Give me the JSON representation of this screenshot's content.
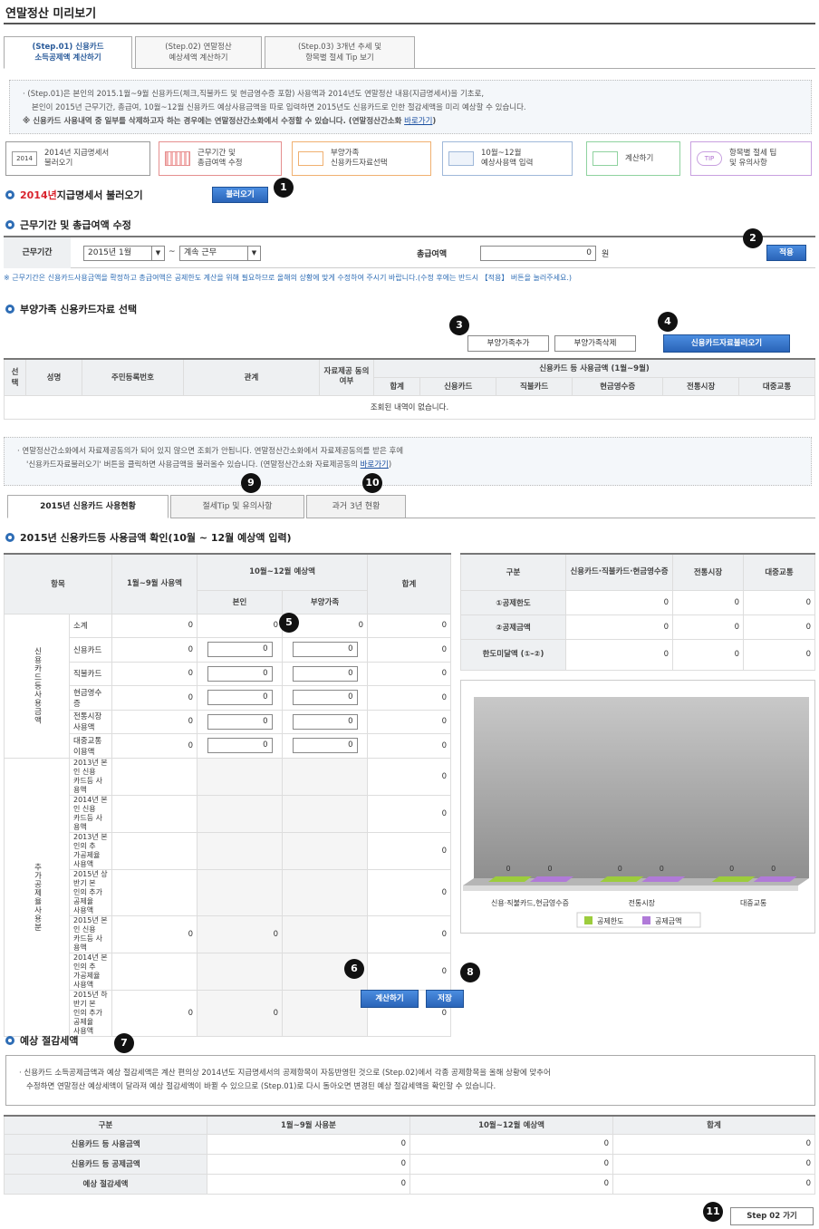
{
  "page": {
    "title": "연말정산 미리보기"
  },
  "steps": [
    {
      "line1": "(Step.01) 신용카드",
      "line2": "소득공제액 계산하기"
    },
    {
      "line1": "(Step.02) 연말정산",
      "line2": "예상세액 계산하기"
    },
    {
      "line1": "(Step.03) 3개년 추세 및",
      "line2": "항목별 절세 Tip 보기"
    }
  ],
  "intro": {
    "line1": "· (Step.01)은 본인의 2015.1월~9월 신용카드(체크,직불카드 및 현금영수증 포함) 사용액과 2014년도 연말정산 내용(지급명세서)을 기초로,",
    "line2": "본인이 2015년 근무기간, 총급여, 10월~12월 신용카드 예상사용금액을 따로 입력하면 2015년도 신용카드로 인한 절감세액을 미리 예상할 수 있습니다.",
    "line3": "※ 신용카드 사용내역 중 일부를 삭제하고자 하는 경우에는 연말정산간소화에서 수정할 수 있습니다. (연말정산간소화",
    "link": "바로가기",
    "close": ")"
  },
  "flow": [
    {
      "icon": "2014",
      "line1": "2014년 지급명세서",
      "line2": "불러오기"
    },
    {
      "icon": "",
      "line1": "근무기간 및",
      "line2": "총급여액 수정"
    },
    {
      "icon": "",
      "line1": "부양가족",
      "line2": "신용카드자료선택"
    },
    {
      "icon": "",
      "line1": "10월~12월",
      "line2": "예상사용액 입력"
    },
    {
      "icon": "",
      "line1": "계산하기",
      "line2": ""
    },
    {
      "icon": "TIP",
      "line1": "항목별 절세 팁",
      "line2": "및 유의사항"
    }
  ],
  "sec1": {
    "title_year": "2014년",
    "title_rest": " 지급명세서 불러오기",
    "button": "불러오기"
  },
  "sec2": {
    "title": "근무기간 및 총급여액 수정",
    "period_label": "근무기간",
    "from": "2015년 1월",
    "tilde": "~",
    "to": "계속 근무",
    "salary_label": "총급여액",
    "salary_value": "0",
    "unit": "원",
    "apply": "적용",
    "note": "※ 근무기간은 신용카드사용금액을 확정하고 총급여액은 공제한도 계산을 위해 필요하므로 올해의 상황에 맞게 수정하여 주시기 바랍니다.(수정 후에는 반드시 【적용】 버튼을 눌러주세요.)"
  },
  "sec3": {
    "title": "부양가족 신용카드자료 선택",
    "add": "부양가족추가",
    "del": "부양가족삭제",
    "load": "신용카드자료불러오기",
    "headers": {
      "select": "선택",
      "name": "성명",
      "rrn": "주민등록번호",
      "rel": "관계",
      "consent": "자료제공 동의여부",
      "group": "신용카드 등 사용금액 (1월~9월)"
    },
    "subheaders": [
      "합계",
      "신용카드",
      "직불카드",
      "현금영수증",
      "전통시장",
      "대중교통"
    ],
    "empty": "조회된 내역이 없습니다."
  },
  "info2": {
    "line1": "· 연말정산간소화에서 자료제공동의가 되어 있지 않으면 조회가 안됩니다. 연말정산간소화에서 자료제공동의를 받은 후에",
    "line2": "'신용카드자료불러오기' 버튼을 클릭하면 사용금액을 불러올수 있습니다. (연말정산간소화 자료제공동의",
    "link": "바로가기",
    "close": ")"
  },
  "tabs": [
    "2015년 신용카드 사용현황",
    "절세Tip 및 유의사항",
    "과거 3년 현황"
  ],
  "sec4": {
    "title": "2015년 신용카드등 사용금액 확인(10월 ~ 12월 예상액 입력)",
    "headers": {
      "item": "항목",
      "janSep": "1월~9월 사용액",
      "octDec": "10월~12월 예상액",
      "self": "본인",
      "dep": "부양가족",
      "total": "합계"
    },
    "group1": "신용카드등사용금액",
    "group2": "추가공제율사용분",
    "rows": [
      {
        "label": "소계",
        "a": "0",
        "b": "0",
        "c": "0",
        "t": "0"
      },
      {
        "label": "신용카드",
        "a": "0",
        "b": "0",
        "c": "0",
        "t": "0"
      },
      {
        "label": "직불카드",
        "a": "0",
        "b": "0",
        "c": "0",
        "t": "0"
      },
      {
        "label": "현금영수증",
        "a": "0",
        "b": "0",
        "c": "0",
        "t": "0"
      },
      {
        "label": "전통시장 사용액",
        "a": "0",
        "b": "0",
        "c": "0",
        "t": "0"
      },
      {
        "label": "대중교통 이용액",
        "a": "0",
        "b": "0",
        "c": "0",
        "t": "0"
      }
    ],
    "rows2": [
      {
        "l1": "2013년 본인 신용",
        "l2": "카드등 사용액",
        "l3": "",
        "a": "",
        "b": "",
        "t": "0"
      },
      {
        "l1": "2014년 본인 신용",
        "l2": "카드등 사용액",
        "l3": "",
        "a": "",
        "b": "",
        "t": "0"
      },
      {
        "l1": "2013년 본인의 추",
        "l2": "가공제율 사용액",
        "l3": "",
        "a": "",
        "b": "",
        "t": "0"
      },
      {
        "l1": "2015년 상반기 본",
        "l2": "인의 추가공제율",
        "l3": "사용액",
        "a": "",
        "b": "",
        "t": "0"
      },
      {
        "l1": "2015년 본인 신용",
        "l2": "카드등 사용액",
        "l3": "",
        "a": "0",
        "b": "0",
        "t": "0"
      },
      {
        "l1": "2014년 본인의 추",
        "l2": "가공제율 사용액",
        "l3": "",
        "a": "",
        "b": "",
        "t": "0"
      },
      {
        "l1": "2015년 하반기 본",
        "l2": "인의 추가공제율",
        "l3": "사용액",
        "a": "0",
        "b": "0",
        "t": "0"
      }
    ],
    "right": {
      "headers": [
        "구분",
        "신용카드·직불카드·현금영수증",
        "전통시장",
        "대중교통"
      ],
      "rows": [
        {
          "label": "①공제한도",
          "v": [
            "0",
            "0",
            "0"
          ]
        },
        {
          "label": "②공제금액",
          "v": [
            "0",
            "0",
            "0"
          ]
        },
        {
          "label": "한도미달액 (①-②)",
          "v": [
            "0",
            "0",
            "0"
          ]
        }
      ]
    },
    "calc": "계산하기",
    "save": "저장"
  },
  "chart_data": {
    "type": "bar",
    "categories": [
      "신용·직불카드,현금영수증",
      "전통시장",
      "대중교통"
    ],
    "series": [
      {
        "name": "공제한도",
        "values": [
          0,
          0,
          0
        ]
      },
      {
        "name": "공제금액",
        "values": [
          0,
          0,
          0
        ]
      }
    ],
    "colors": [
      "#9ccc3c",
      "#b07ad8"
    ],
    "legend": "bottom"
  },
  "sec5": {
    "title": "예상 절감세액",
    "line1": "· 신용카드 소득공제금액과 예상 절감세액은 계산 편의상 2014년도 지급명세서의 공제항목이 자동반영된 것으로 (Step.02)에서 각종 공제항목을 올해 상황에 맞추어",
    "line2": "수정하면 연말정산 예상세액이 달라져 예상 절감세액이 바뀔 수 있으므로 (Step.01)로 다시 돌아오면 변경된 예상 절감세액을 확인할 수 있습니다.",
    "headers": [
      "구분",
      "1월~9월 사용분",
      "10월~12월 예상액",
      "합계"
    ],
    "rows": [
      {
        "label": "신용카드 등 사용금액",
        "v": [
          "0",
          "0",
          "0"
        ]
      },
      {
        "label": "신용카드 등 공제금액",
        "v": [
          "0",
          "0",
          "0"
        ]
      },
      {
        "label": "예상 절감세액",
        "v": [
          "0",
          "0",
          "0"
        ]
      }
    ]
  },
  "next": "Step 02 가기",
  "markers": [
    "1",
    "2",
    "3",
    "4",
    "9",
    "10",
    "5",
    "6",
    "8",
    "7",
    "11"
  ]
}
